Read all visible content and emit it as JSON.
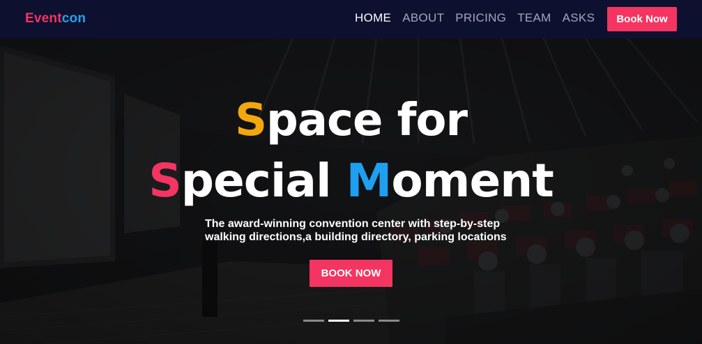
{
  "brand": {
    "part1": "Event",
    "part2": "con"
  },
  "nav": {
    "items": [
      {
        "label": "HOME",
        "active": true
      },
      {
        "label": "ABOUT",
        "active": false
      },
      {
        "label": "PRICING",
        "active": false
      },
      {
        "label": "TEAM",
        "active": false
      },
      {
        "label": "ASKS",
        "active": false
      }
    ],
    "book_label": "Book Now"
  },
  "hero": {
    "line1": {
      "first_letter": "S",
      "rest": "pace for"
    },
    "line2": {
      "s_letter": "S",
      "s_rest": "pecial ",
      "m_letter": "M",
      "m_rest": "oment"
    },
    "subtitle_line1": "The award-winning convention center with step-by-step",
    "subtitle_line2": "walking directions,a building directory, parking locations",
    "cta_label": "BOOK NOW",
    "slides": {
      "count": 4,
      "active_index": 1
    }
  },
  "colors": {
    "accent_pink": "#f43561",
    "accent_blue": "#1e9ff0",
    "accent_yellow": "#f2a80c",
    "navbar_bg": "#0e1030"
  }
}
